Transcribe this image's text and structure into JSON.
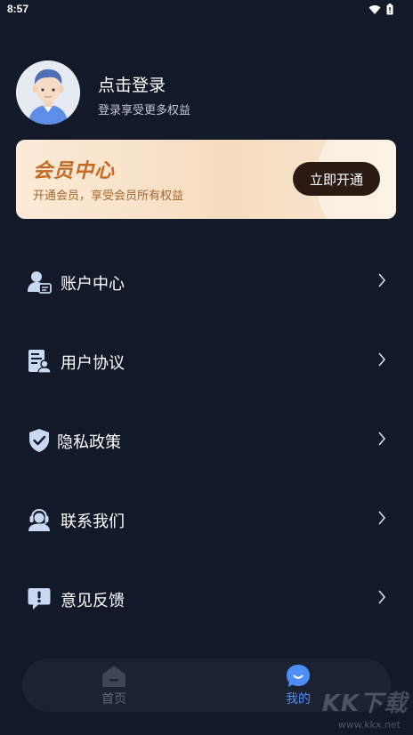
{
  "status_bar": {
    "time": "8:57",
    "icons": [
      "wifi-icon",
      "battery-icon"
    ]
  },
  "profile": {
    "name": "点击登录",
    "subtitle": "登录享受更多权益",
    "avatar_icon": "avatar-icon"
  },
  "vip": {
    "title": "会员中心",
    "subtitle": "开通会员，享受会员所有权益",
    "button_label": "立即开通"
  },
  "menu": {
    "items": [
      {
        "label": "账户中心",
        "icon": "account-icon"
      },
      {
        "label": "用户协议",
        "icon": "agreement-icon"
      },
      {
        "label": "隐私政策",
        "icon": "shield-icon"
      },
      {
        "label": "联系我们",
        "icon": "headset-icon"
      },
      {
        "label": "意见反馈",
        "icon": "feedback-icon"
      }
    ]
  },
  "tabs": [
    {
      "label": "首页",
      "icon": "home-icon",
      "active": false
    },
    {
      "label": "我的",
      "icon": "smile-icon",
      "active": true
    }
  ],
  "watermark": {
    "text": "KK下载",
    "url": "www.kkx.net"
  },
  "colors": {
    "background": "#121a29",
    "accent": "#4e8df6",
    "vip_title": "#c46a24",
    "vip_button": "#2a1a12",
    "icon": "#c9d8f3"
  }
}
